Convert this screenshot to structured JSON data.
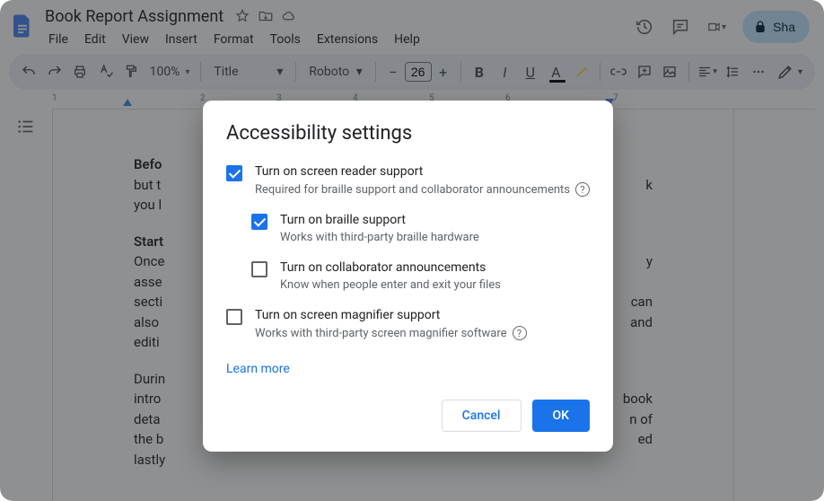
{
  "doc": {
    "title": "Book Report Assignment"
  },
  "menus": {
    "file": "File",
    "edit": "Edit",
    "view": "View",
    "insert": "Insert",
    "format": "Format",
    "tools": "Tools",
    "extensions": "Extensions",
    "help": "Help"
  },
  "toolbar": {
    "zoom": "100%",
    "style": "Title",
    "font": "Roboto",
    "font_size": "26"
  },
  "share": {
    "label": "Sha"
  },
  "ruler": {
    "n1": "1",
    "n2": "2",
    "n3": "3",
    "n4": "4",
    "n5": "5",
    "n6": "6",
    "n7": "7"
  },
  "body": {
    "p1a": "Befo",
    "p1b": "but t",
    "p1c": "you l",
    "p1end_b": "k",
    "p2a": "Start",
    "p2b": "Once",
    "p2c": "asse",
    "p2d": "secti",
    "p2e": "also",
    "p2f": "editi",
    "p2end_b": "y",
    "p2end_d": "can",
    "p2end_e": "and",
    "p3a": "Durin",
    "p3b": "intro",
    "p3c": "deta",
    "p3d": "the b",
    "p3e": "lastly",
    "p3end_b": "book",
    "p3end_c": "n of",
    "p3end_d": "ed"
  },
  "dialog": {
    "title": "Accessibility settings",
    "opt1": {
      "label": "Turn on screen reader support",
      "desc": "Required for braille support and collaborator announcements"
    },
    "opt2": {
      "label": "Turn on braille support",
      "desc": "Works with third-party braille hardware"
    },
    "opt3": {
      "label": "Turn on collaborator announcements",
      "desc": "Know when people enter and exit your files"
    },
    "opt4": {
      "label": "Turn on screen magnifier support",
      "desc": "Works with third-party screen magnifier software"
    },
    "learn_more": "Learn more",
    "cancel": "Cancel",
    "ok": "OK",
    "help": "?"
  }
}
